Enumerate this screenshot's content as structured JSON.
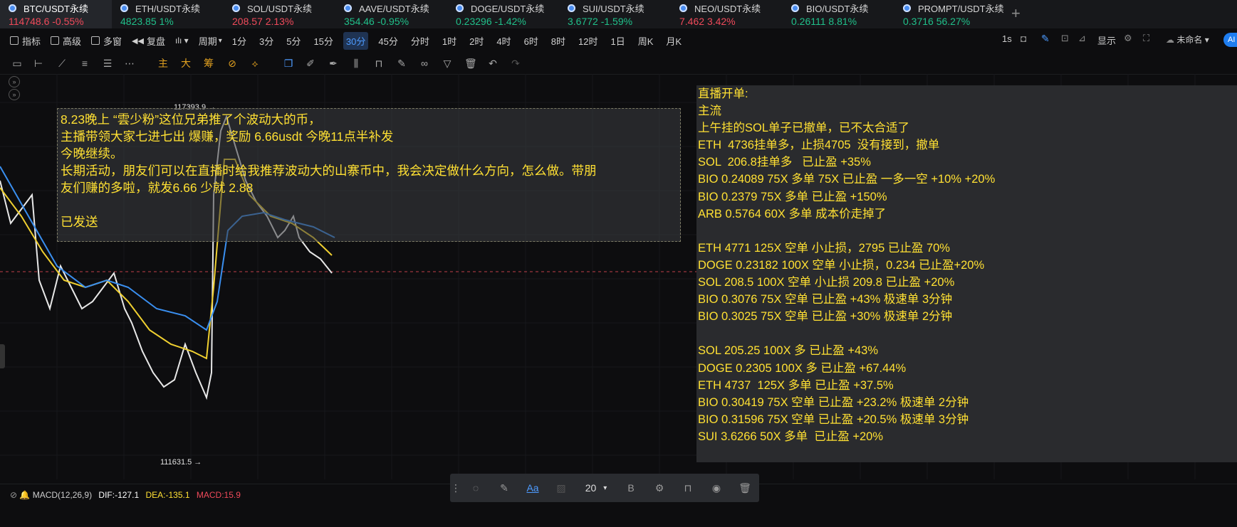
{
  "tabs": [
    {
      "name": "BTC/USDT永续",
      "price": "114748.6",
      "change": "-0.55%",
      "dir": "down",
      "active": true
    },
    {
      "name": "ETH/USDT永续",
      "price": "4823.85",
      "change": "1%",
      "dir": "up",
      "active": false
    },
    {
      "name": "SOL/USDT永续",
      "price": "208.57",
      "change": "2.13%",
      "dir": "down",
      "active": false
    },
    {
      "name": "AAVE/USDT永续",
      "price": "354.46",
      "change": "-0.95%",
      "dir": "up",
      "active": false
    },
    {
      "name": "DOGE/USDT永续",
      "price": "0.23296",
      "change": "-1.42%",
      "dir": "up",
      "active": false
    },
    {
      "name": "SUI/USDT永续",
      "price": "3.6772",
      "change": "-1.59%",
      "dir": "up",
      "active": false
    },
    {
      "name": "NEO/USDT永续",
      "price": "7.462",
      "change": "3.42%",
      "dir": "down",
      "active": false
    },
    {
      "name": "BIO/USDT永续",
      "price": "0.26111",
      "change": "8.81%",
      "dir": "up",
      "active": false
    },
    {
      "name": "PROMPT/USDT永续",
      "price": "0.3716",
      "change": "56.27%",
      "dir": "up",
      "active": false
    }
  ],
  "add_tab": "+",
  "toolbar": {
    "indicator": "指标",
    "advanced": "高级",
    "multi_window": "多窗",
    "replay": "复盘",
    "period_label": "周期",
    "periods": [
      "1分",
      "3分",
      "5分",
      "15分",
      "30分",
      "45分",
      "分时",
      "1时",
      "2时",
      "4时",
      "6时",
      "8时",
      "12时",
      "1日",
      "周K",
      "月K"
    ],
    "selected_period": "30分",
    "interval": "1s",
    "display": "显示",
    "unnamed": "未命名",
    "ai": "AI"
  },
  "draw_tools": {
    "main": "主",
    "big": "大",
    "chips": "筹"
  },
  "chart": {
    "high_label": "117393.9",
    "low_label": "111631.5",
    "accent": "#ffe033"
  },
  "overlay_note": [
    "8.23晚上 “雲少粉”这位兄弟推了个波动大的币，",
    "主播带领大家七进七出 爆赚，奖励 6.66usdt 今晚11点半补发",
    "今晚继续。",
    "长期活动，朋友们可以在直播时给我推荐波动大的山寨币中，我会决定做什么方向，怎么做。带朋",
    "友们赚的多啦，就发6.66 少就 2.88",
    "",
    "已发送"
  ],
  "trade_log": [
    "直播开单:",
    "主流",
    "上午挂的SOL单子已撤单，已不太合适了",
    "ETH  4736挂单多，止损4705  没有接到，撤单",
    "SOL  206.8挂单多   已止盈 +35%",
    "BIO 0.24089 75X 多单 75X 已止盈 一多一空 +10% +20%",
    "BIO 0.2379 75X 多单 已止盈 +150%",
    "ARB 0.5764 60X 多单 成本价走掉了",
    "",
    "ETH 4771 125X 空单 小止损，2795 已止盈 70%",
    "DOGE 0.23182 100X 空单 小止损，0.234 已止盈+20%",
    "SOL 208.5 100X 空单 小止损 209.8 已止盈 +20%",
    "BIO 0.3076 75X 空单 已止盈 +43% 极速单 3分钟",
    "BIO 0.3025 75X 空单 已止盈 +30% 极速单 2分钟",
    "",
    "SOL 205.25 100X 多 已止盈 +43%",
    "DOGE 0.2305 100X 多 已止盈 +67.44%",
    "ETH 4737  125X 多单 已止盈 +37.5%",
    "BIO 0.30419 75X 空单 已止盈 +23.2% 极速单 2分钟",
    "BIO 0.31596 75X 空单 已止盈 +20.5% 极速单 3分钟",
    "SUI 3.6266 50X 多单  已止盈 +20%"
  ],
  "macd": {
    "name": "MACD(12,26,9)",
    "dif": "DIF:-127.1",
    "dea": "DEA:-135.1",
    "macd": "MACD:15.9"
  },
  "text_toolbar": {
    "font_size": "20",
    "bold": "B",
    "text_icon": "Aa"
  }
}
